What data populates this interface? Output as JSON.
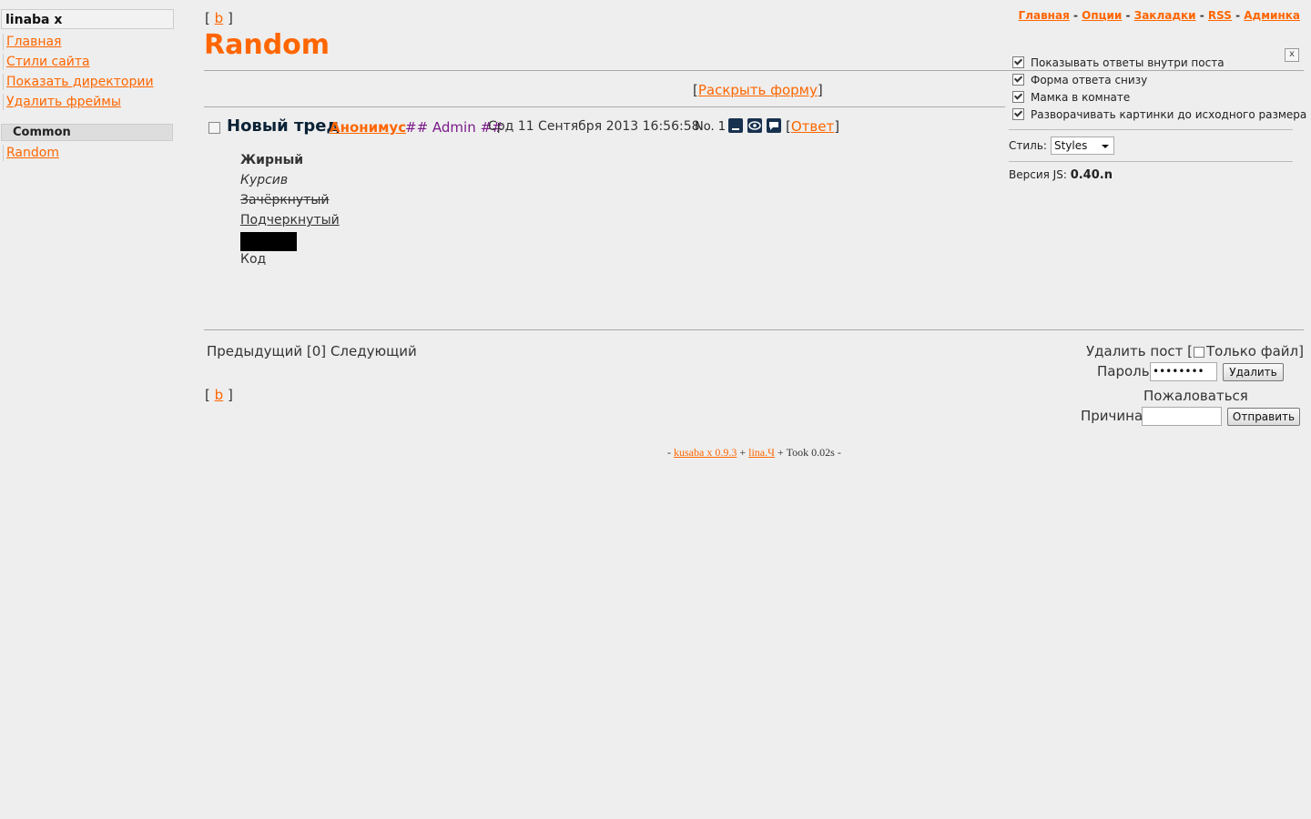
{
  "sidebar": {
    "title": "linaba x",
    "links": [
      "Главная",
      "Стили сайта",
      "Показать директории",
      "Удалить фреймы"
    ],
    "category": "Common",
    "boards": [
      "Random"
    ]
  },
  "nav": {
    "board_short": "b",
    "open_bracket": "[",
    "close_bracket": "]"
  },
  "header": {
    "board_title": "Random",
    "top_links": [
      "Главная",
      "Опции",
      "Закладки",
      "RSS",
      "Админка"
    ],
    "separator": " - "
  },
  "settings": {
    "options": [
      {
        "label": "Показывать ответы внутри поста",
        "checked": true
      },
      {
        "label": "Форма ответа снизу",
        "checked": true
      },
      {
        "label": "Мамка в комнате",
        "checked": true
      },
      {
        "label": "Разворачивать картинки до исходного размера",
        "checked": true
      }
    ],
    "close_label": "x",
    "style_label": "Стиль:",
    "style_value": "Styles",
    "version_label": "Версия JS:",
    "version_value": "0.40.n"
  },
  "expand_form": {
    "label": "Раскрыть форму"
  },
  "thread": {
    "subject": "Новый тред",
    "name": "Анонимус",
    "trip": "## Admin ##",
    "date": "Срд 11 Сентября 2013 16:56:58",
    "number": "No. 1",
    "reply_label": "Ответ",
    "icons": [
      "hide-icon",
      "watch-icon",
      "quick-reply-icon"
    ],
    "body": {
      "bold": "Жирный",
      "italic": "Курсив",
      "strike": "Зачёркнутый",
      "underline": "Подчеркнутый",
      "code": "Код"
    }
  },
  "pager": {
    "prev": "Предыдущий",
    "current": "[0]",
    "next": "Следующий"
  },
  "delete_form": {
    "delete_label": "Удалить пост [",
    "only_file": "Только файл]",
    "password_label": "Пароль",
    "password_value": "••••••••",
    "delete_button": "Удалить",
    "report_label": "Пожаловаться",
    "reason_label": "Причина",
    "reason_value": "",
    "send_button": "Отправить"
  },
  "footer": {
    "dash_start": "- ",
    "kusaba": "kusaba x 0.9.3",
    "plus1": " + ",
    "lina": "lina.Ч",
    "took": " + Took 0.02s -"
  },
  "colors": {
    "accent": "#ff6600",
    "trip": "#7b1a8a",
    "background": "#eeeeee"
  }
}
